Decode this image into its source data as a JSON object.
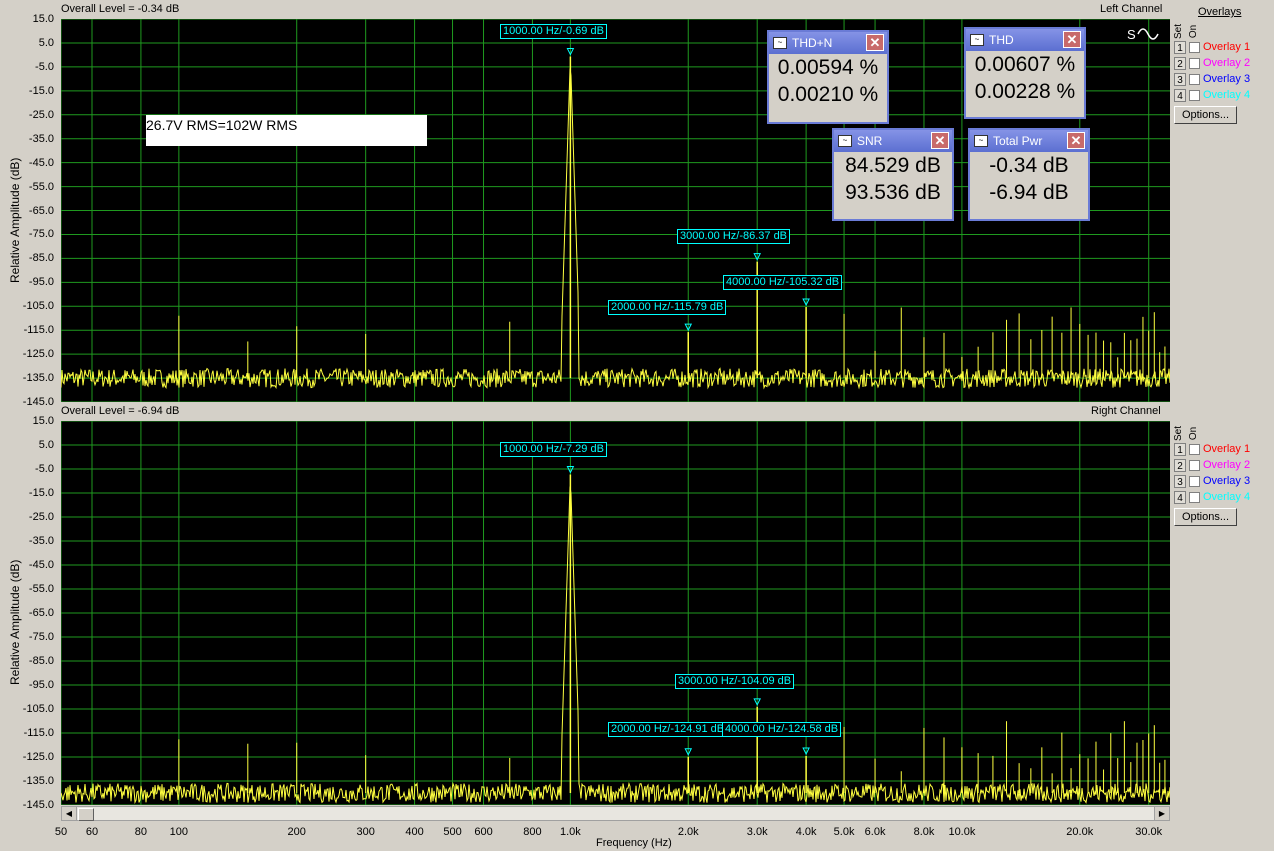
{
  "top": {
    "overall_level": "Overall Level = -0.34 dB",
    "channel": "Left Channel",
    "ylabel": "Relative Amplitude (dB)",
    "note": "26.7V RMS=102W RMS",
    "annotations": [
      "1000.00 Hz/-0.69 dB",
      "3000.00 Hz/-86.37 dB",
      "4000.00 Hz/-105.32 dB",
      "2000.00 Hz/-115.79 dB"
    ],
    "spectrum": {
      "fundamental_db": -0.69,
      "h2_db": -115.79,
      "h3_db": -86.37,
      "h4_db": -105.32,
      "floor_db": -135
    }
  },
  "bottom": {
    "overall_level": "Overall Level = -6.94 dB",
    "channel": "Right Channel",
    "ylabel": "Relative Amplitude (dB)",
    "annotations": [
      "1000.00 Hz/-7.29 dB",
      "3000.00 Hz/-104.09 dB",
      "2000.00 Hz/-124.91 dB",
      "4000.00 Hz/-124.58 dB"
    ],
    "spectrum": {
      "fundamental_db": -7.29,
      "h2_db": -124.91,
      "h3_db": -104.09,
      "h4_db": -124.58,
      "floor_db": -140
    }
  },
  "yticks": [
    "15.0",
    "5.0",
    "-5.0",
    "-15.0",
    "-25.0",
    "-35.0",
    "-45.0",
    "-55.0",
    "-65.0",
    "-75.0",
    "-85.0",
    "-95.0",
    "-105.0",
    "-115.0",
    "-125.0",
    "-135.0",
    "-145.0"
  ],
  "xticks": [
    "50",
    "60",
    "80",
    "100",
    "200",
    "300",
    "400",
    "500",
    "600",
    "800",
    "1.0k",
    "2.0k",
    "3.0k",
    "4.0k",
    "5.0k",
    "6.0k",
    "8.0k",
    "10.0k",
    "20.0k",
    "30.0k"
  ],
  "xlabel": "Frequency (Hz)",
  "overlays": {
    "header_set": "Set",
    "header_on": "On",
    "header_title": "Overlays",
    "items": [
      {
        "num": "1",
        "label": "Overlay 1",
        "color": "#ff0000"
      },
      {
        "num": "2",
        "label": "Overlay 2",
        "color": "#ff00ff"
      },
      {
        "num": "3",
        "label": "Overlay 3",
        "color": "#0000ff"
      },
      {
        "num": "4",
        "label": "Overlay 4",
        "color": "#00ffff"
      }
    ],
    "options_label": "Options..."
  },
  "meters": {
    "thdn": {
      "title": "THD+N",
      "v1": "0.00594 %",
      "v2": "0.00210 %"
    },
    "thd": {
      "title": "THD",
      "v1": "0.00607 %",
      "v2": "0.00228 %"
    },
    "snr": {
      "title": "SNR",
      "v1": "84.529 dB",
      "v2": "93.536 dB"
    },
    "pwr": {
      "title": "Total Pwr",
      "v1": "-0.34 dB",
      "v2": "-6.94 dB"
    }
  },
  "colors": {
    "trace": "#ffff40",
    "grid": "#1f9a1f",
    "annotation": "#00ffff",
    "plot_bg": "#000000"
  }
}
